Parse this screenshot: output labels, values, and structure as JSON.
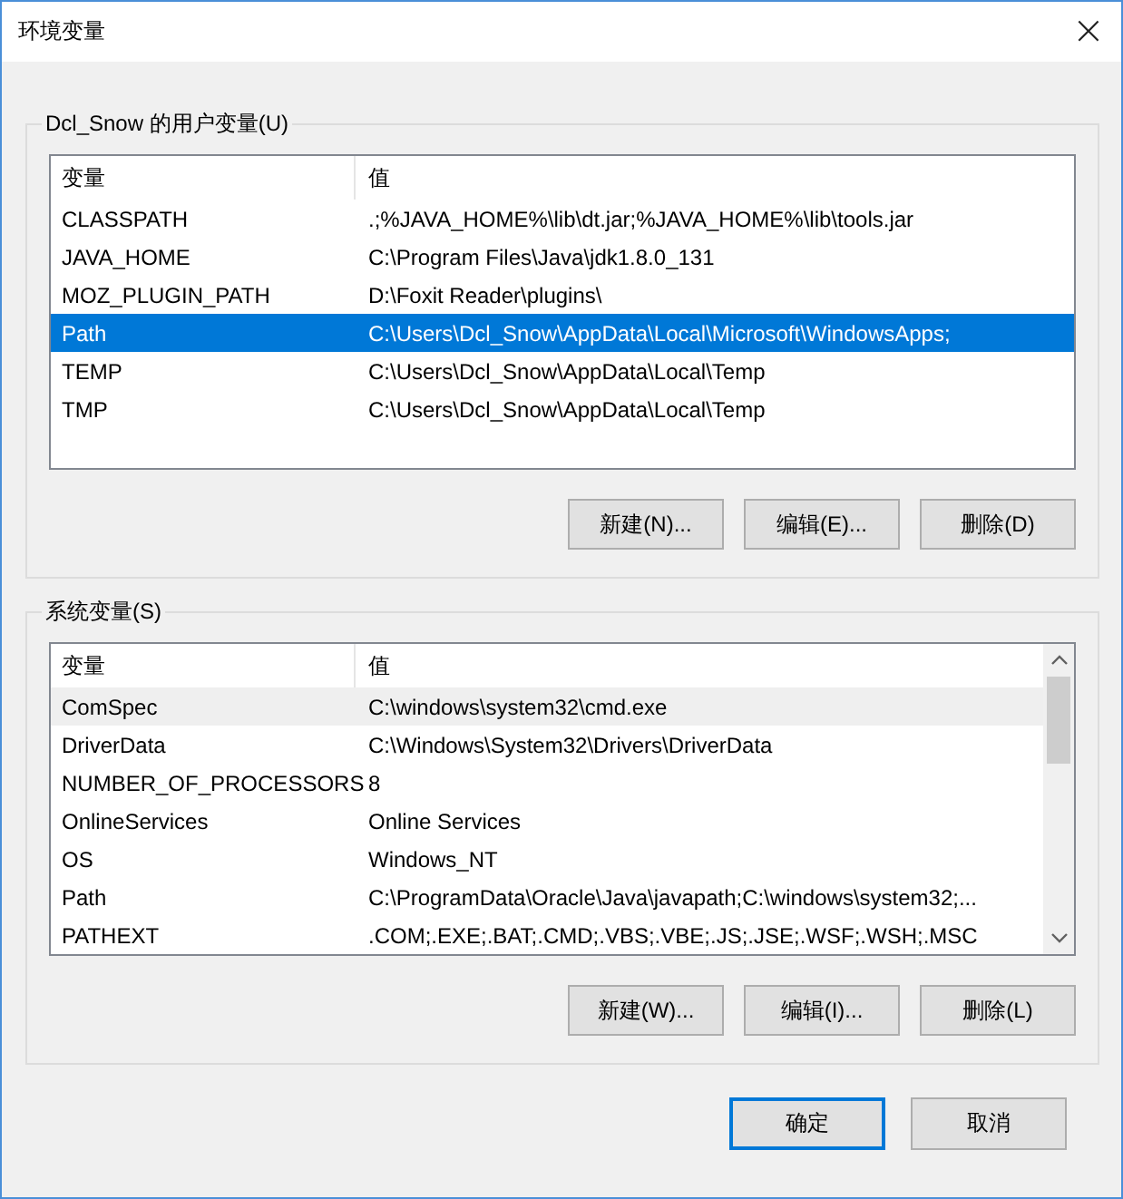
{
  "window": {
    "title": "环境变量",
    "close": "×"
  },
  "user_vars": {
    "label": "Dcl_Snow 的用户变量(U)",
    "columns": [
      "变量",
      "值"
    ],
    "rows": [
      {
        "name": "CLASSPATH",
        "value": ".;%JAVA_HOME%\\lib\\dt.jar;%JAVA_HOME%\\lib\\tools.jar",
        "selected": false,
        "hovered": false
      },
      {
        "name": "JAVA_HOME",
        "value": "C:\\Program Files\\Java\\jdk1.8.0_131",
        "selected": false,
        "hovered": false
      },
      {
        "name": "MOZ_PLUGIN_PATH",
        "value": "D:\\Foxit Reader\\plugins\\",
        "selected": false,
        "hovered": false
      },
      {
        "name": "Path",
        "value": "C:\\Users\\Dcl_Snow\\AppData\\Local\\Microsoft\\WindowsApps;",
        "selected": true,
        "hovered": false
      },
      {
        "name": "TEMP",
        "value": "C:\\Users\\Dcl_Snow\\AppData\\Local\\Temp",
        "selected": false,
        "hovered": false
      },
      {
        "name": "TMP",
        "value": "C:\\Users\\Dcl_Snow\\AppData\\Local\\Temp",
        "selected": false,
        "hovered": false
      }
    ],
    "buttons": [
      "新建(N)...",
      "编辑(E)...",
      "删除(D)"
    ]
  },
  "system_vars": {
    "label": "系统变量(S)",
    "columns": [
      "变量",
      "值"
    ],
    "rows": [
      {
        "name": "ComSpec",
        "value": "C:\\windows\\system32\\cmd.exe",
        "selected": false,
        "hovered": true
      },
      {
        "name": "DriverData",
        "value": "C:\\Windows\\System32\\Drivers\\DriverData",
        "selected": false,
        "hovered": false
      },
      {
        "name": "NUMBER_OF_PROCESSORS",
        "value": "8",
        "selected": false,
        "hovered": false
      },
      {
        "name": "OnlineServices",
        "value": "Online Services",
        "selected": false,
        "hovered": false
      },
      {
        "name": "OS",
        "value": "Windows_NT",
        "selected": false,
        "hovered": false
      },
      {
        "name": "Path",
        "value": "C:\\ProgramData\\Oracle\\Java\\javapath;C:\\windows\\system32;...",
        "selected": false,
        "hovered": false
      },
      {
        "name": "PATHEXT",
        "value": ".COM;.EXE;.BAT;.CMD;.VBS;.VBE;.JS;.JSE;.WSF;.WSH;.MSC",
        "selected": false,
        "hovered": false
      }
    ],
    "scrollbar": true,
    "buttons": [
      "新建(W)...",
      "编辑(I)...",
      "删除(L)"
    ]
  },
  "footer_buttons": [
    {
      "label": "确定",
      "default": true
    },
    {
      "label": "取消",
      "default": false
    }
  ]
}
